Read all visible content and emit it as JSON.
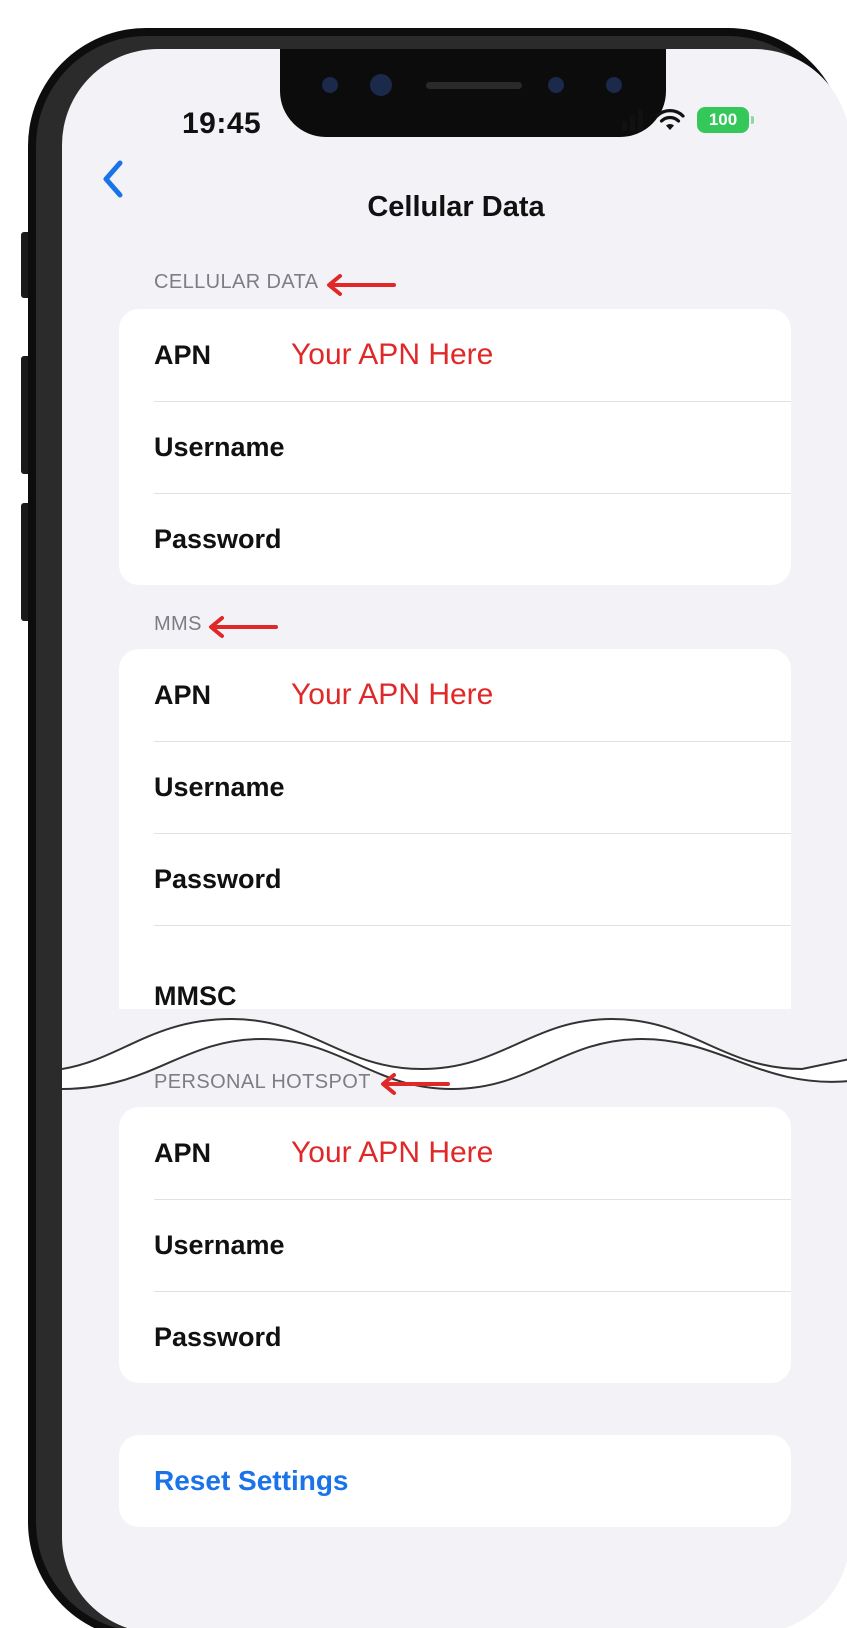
{
  "status_bar": {
    "time": "19:45",
    "battery_level": "100"
  },
  "nav": {
    "title": "Cellular Data"
  },
  "sections": [
    {
      "header": "CELLULAR DATA",
      "rows": [
        {
          "label": "APN",
          "value": "Your APN Here"
        },
        {
          "label": "Username",
          "value": ""
        },
        {
          "label": "Password",
          "value": ""
        }
      ]
    },
    {
      "header": "MMS",
      "rows": [
        {
          "label": "APN",
          "value": "Your APN Here"
        },
        {
          "label": "Username",
          "value": ""
        },
        {
          "label": "Password",
          "value": ""
        },
        {
          "label": "MMSC",
          "value": ""
        }
      ]
    },
    {
      "header": "PERSONAL HOTSPOT",
      "rows": [
        {
          "label": "APN",
          "value": "Your APN Here"
        },
        {
          "label": "Username",
          "value": ""
        },
        {
          "label": "Password",
          "value": ""
        }
      ]
    }
  ],
  "reset": {
    "label": "Reset Settings"
  },
  "colors": {
    "annotation": "#e02828",
    "link": "#1a73e8",
    "background": "#f2f2f7"
  }
}
